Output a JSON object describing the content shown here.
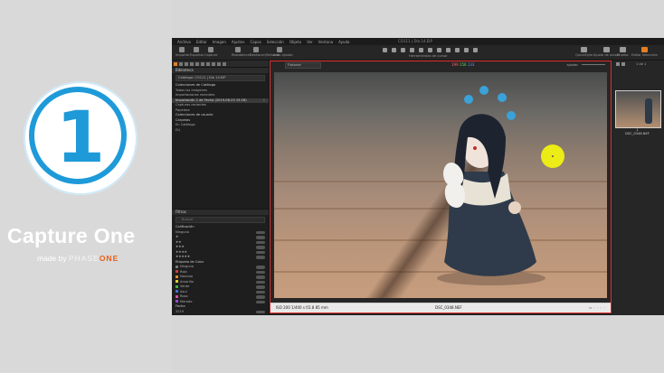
{
  "promo": {
    "logo_digit": "1",
    "brand_name": "Capture One",
    "made_by": "made by",
    "phase": "PHASE",
    "one": "ONE",
    "accent": "#1e9ad9",
    "one_color": "#e95d14"
  },
  "app": {
    "menu": [
      "Archivo",
      "Editar",
      "Imagen",
      "Ajustes",
      "Capas",
      "Selección",
      "Objeto",
      "Ver",
      "Ventana",
      "Ayuda"
    ],
    "window_title": "CO111 | Día 14.EIP",
    "toolbar_left": [
      {
        "label": "Importar",
        "icon": "import-icon"
      },
      {
        "label": "Exportar",
        "icon": "export-icon"
      },
      {
        "label": "Capture",
        "icon": "camera-icon"
      }
    ],
    "toolbar_mid": [
      {
        "label": "Restablecer",
        "icon": "reset-icon"
      },
      {
        "label": "Deshacer/Rehacer",
        "icon": "undo-icon"
      },
      {
        "label": "Auto ajustar",
        "icon": "auto-adjust-icon"
      }
    ],
    "cursor_tools_label": "Herramientas de cursor",
    "toolbar_right": [
      {
        "label": "QuickStyle",
        "icon": "quickstyle-icon"
      },
      {
        "label": "Ajuste de avisos",
        "icon": "warning-icon"
      },
      {
        "label": "Prueba",
        "icon": "proof-icon"
      },
      {
        "label": "Editar Selección",
        "icon": "edit-selection-icon"
      }
    ],
    "library": {
      "header": "Biblioteca",
      "catalog_select": "Catálogo: CO111 | Día 14.EIP",
      "sections": [
        {
          "type": "header",
          "label": "Colecciones de Catálogo"
        },
        {
          "type": "row",
          "label": "Todas las imágenes",
          "count": ""
        },
        {
          "type": "row",
          "label": "Importaciones recientes",
          "count": ""
        },
        {
          "type": "row",
          "label": "Importación 1 de Fecha (2019-06-25 15:26)",
          "count": "1",
          "selected": true
        },
        {
          "type": "row",
          "label": "Capturas recientes",
          "count": ""
        },
        {
          "type": "row",
          "label": "Papelera",
          "count": ""
        },
        {
          "type": "header",
          "label": "Colecciones de usuario"
        },
        {
          "type": "header",
          "label": "Carpetas"
        },
        {
          "type": "row",
          "label": "En Catálogo",
          "count": ""
        },
        {
          "type": "row",
          "label": "D:\\",
          "count": ""
        }
      ]
    },
    "filters": {
      "header": "Filtros",
      "search_placeholder": "Buscar",
      "rating_header": "Calificación",
      "ratings": [
        "Ninguna",
        "★",
        "★★",
        "★★★",
        "★★★★",
        "★★★★★"
      ],
      "color_header": "Etiqueta de Color",
      "colors": [
        {
          "label": "Ninguna",
          "color": "#777777"
        },
        {
          "label": "Rojo",
          "color": "#d33c3c"
        },
        {
          "label": "Naranja",
          "color": "#e08a2e"
        },
        {
          "label": "Amarillo",
          "color": "#d9cf2e"
        },
        {
          "label": "Verde",
          "color": "#3cae44"
        },
        {
          "label": "Azul",
          "color": "#3f6ed9"
        },
        {
          "label": "Rosa",
          "color": "#d24fa6"
        },
        {
          "label": "Morado",
          "color": "#8e4bd0"
        }
      ],
      "folder_header": "Fecha",
      "year": "2019"
    },
    "viewer": {
      "mode_select": "Flotante",
      "histogram_r": "199",
      "histogram_g": "156",
      "histogram_b": "133",
      "zoom_label": "ajustar",
      "meta": "ISO 200   1/400 s   f/2.8   85 mm",
      "filename": "DSC_0348.NEF",
      "highlight_color": "#e53030"
    },
    "browser": {
      "count": "1 de 1",
      "thumb_caption_1": "1",
      "thumb_caption_2": "DSC_0348.NEF"
    }
  }
}
